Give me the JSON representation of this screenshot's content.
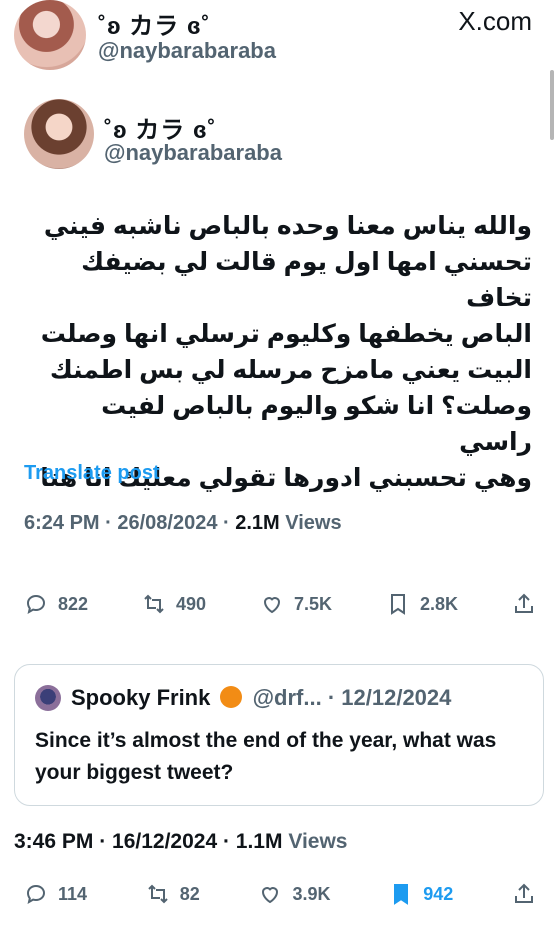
{
  "outer": {
    "display_name": "˚ʚ カラ ɞ˚",
    "handle": "@naybarabaraba",
    "site_label": "X.com"
  },
  "inner": {
    "display_name": "˚ʚ カラ ɞ˚",
    "handle": "@naybarabaraba",
    "text": "والله يناس معنا وحده بالباص ناشبه فيني\nتحسني امها اول يوم قالت لي بضيفك تخاف\nالباص يخطفها وكليوم ترسلي انها وصلت\nالبيت يعني مامزح مرسله لي بس اطمنك\nوصلت؟ انا شكو واليوم بالباص لفيت راسي\nوهي تحسبني ادورها تقولي معليك انا هنا",
    "translate_label": "Translate post",
    "time": "6:24 PM · 26/08/2024 · ",
    "views_count": "2.1M",
    "views_label": " Views",
    "actions": {
      "replies": "822",
      "reposts": "490",
      "likes": "7.5K",
      "bookmarks": "2.8K"
    }
  },
  "quote": {
    "author_name": "Spooky Frink",
    "author_handle_date": "@drf... · 12/12/2024",
    "text": "Since it’s almost the end of the year, what was your biggest tweet?"
  },
  "outer_post": {
    "time": "3:46 PM · 16/12/2024 · ",
    "views_count": "1.1M",
    "views_label": " Views",
    "actions": {
      "replies": "114",
      "reposts": "82",
      "likes": "3.9K",
      "bookmarks": "942"
    }
  },
  "colors": {
    "link": "#1d9bf0",
    "muted": "#536471",
    "text": "#0f1419",
    "border": "#cfd9de"
  },
  "icons": [
    "reply-icon",
    "repost-icon",
    "like-icon",
    "bookmark-icon",
    "share-icon",
    "pumpkin-icon"
  ]
}
